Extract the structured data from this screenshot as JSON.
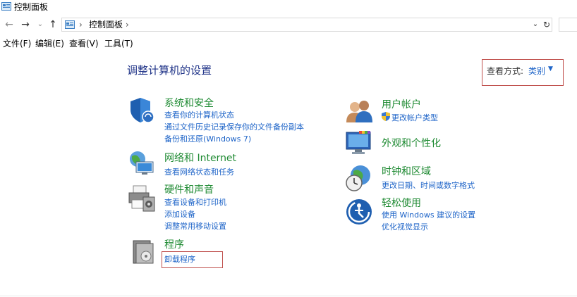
{
  "window": {
    "title": "控制面板"
  },
  "address": {
    "path_item": "控制面板",
    "separator": "›"
  },
  "nav": {
    "back": "←",
    "forward": "→",
    "recent": "⌄",
    "up": "↑",
    "dropdown": "⌄",
    "refresh": "↻"
  },
  "menu": [
    "文件(F)",
    "编辑(E)",
    "查看(V)",
    "工具(T)"
  ],
  "main": {
    "title": "调整计算机的设置",
    "view_by": {
      "label": "查看方式:",
      "value": "类别",
      "caret": "▼"
    }
  },
  "categories_left": [
    {
      "title": "系统和安全",
      "icon": "shield-icon",
      "links": [
        "查看你的计算机状态",
        "通过文件历史记录保存你的文件备份副本",
        "备份和还原(Windows 7)"
      ]
    },
    {
      "title": "网络和 Internet",
      "icon": "network-icon",
      "links": [
        "查看网络状态和任务"
      ]
    },
    {
      "title": "硬件和声音",
      "icon": "printer-icon",
      "links": [
        "查看设备和打印机",
        "添加设备",
        "调整常用移动设置"
      ]
    },
    {
      "title": "程序",
      "icon": "programs-icon",
      "links": [
        "卸载程序"
      ]
    }
  ],
  "categories_right": [
    {
      "title": "用户帐户",
      "icon": "users-icon",
      "links": [
        "更改帐户类型"
      ]
    },
    {
      "title": "外观和个性化",
      "icon": "appearance-icon",
      "links": []
    },
    {
      "title": "时钟和区域",
      "icon": "clock-globe-icon",
      "links": [
        "更改日期、时间或数字格式"
      ]
    },
    {
      "title": "轻松使用",
      "icon": "ease-of-access-icon",
      "links": [
        "使用 Windows 建议的设置",
        "优化视觉显示"
      ]
    }
  ],
  "colors": {
    "accent_link": "#1e64c8",
    "category_green": "#1e8a32",
    "title_blue": "#1e3287",
    "highlight_red": "#c0504d"
  }
}
